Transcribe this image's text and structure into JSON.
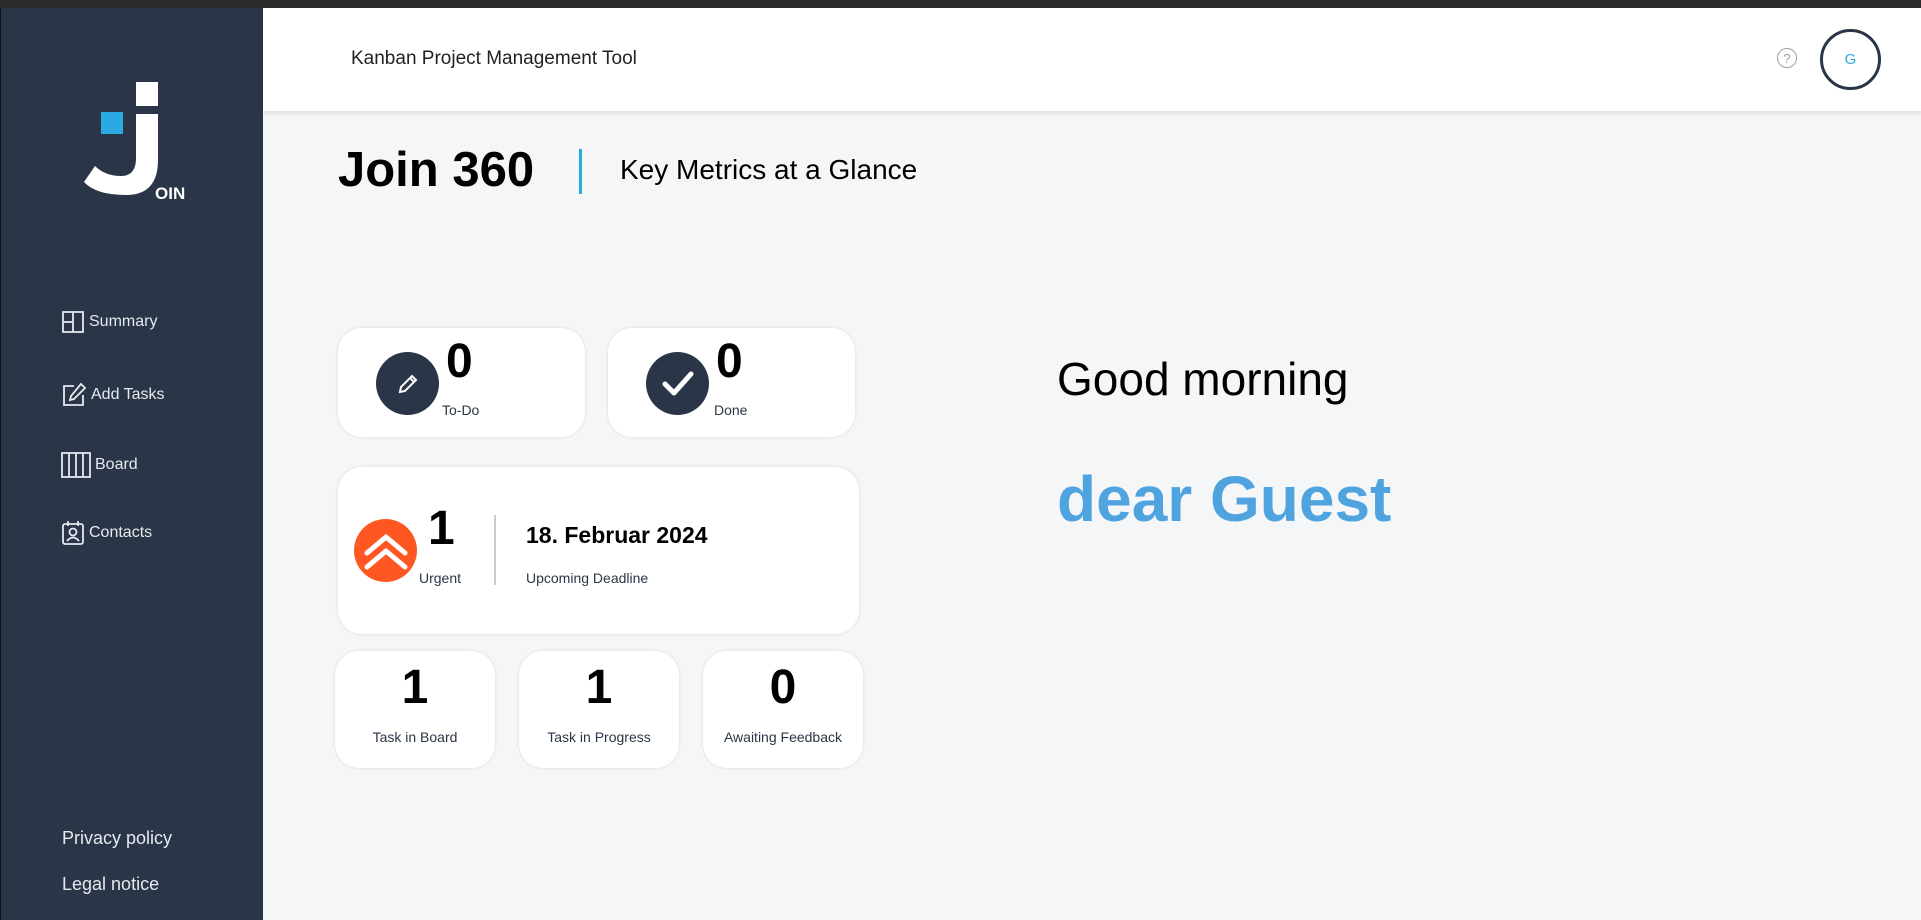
{
  "app": {
    "header_title": "Kanban Project Management Tool",
    "help_label": "?",
    "avatar_initial": "G",
    "logo_suffix": "OIN"
  },
  "sidebar": {
    "items": [
      {
        "label": "Summary",
        "icon": "summary-icon"
      },
      {
        "label": "Add Tasks",
        "icon": "add-task-icon"
      },
      {
        "label": "Board",
        "icon": "board-icon"
      },
      {
        "label": "Contacts",
        "icon": "contacts-icon"
      }
    ],
    "footer": {
      "privacy": "Privacy policy",
      "legal": "Legal notice"
    }
  },
  "page": {
    "title": "Join 360",
    "subtitle": "Key Metrics at a Glance"
  },
  "metrics": {
    "todo": {
      "value": "0",
      "label": "To-Do"
    },
    "done": {
      "value": "0",
      "label": "Done"
    },
    "urgent": {
      "value": "1",
      "label": "Urgent"
    },
    "deadline": {
      "date": "18. Februar 2024",
      "label": "Upcoming Deadline"
    },
    "board": {
      "value": "1",
      "label": "Task in Board"
    },
    "progress": {
      "value": "1",
      "label": "Task in Progress"
    },
    "feedback": {
      "value": "0",
      "label": "Awaiting Feedback"
    }
  },
  "greeting": {
    "text": "Good morning",
    "name": "dear Guest"
  },
  "colors": {
    "sidebar": "#2a3647",
    "accent": "#29abe2",
    "guest_name": "#4fa3df",
    "urgent": "#ff3d00"
  }
}
